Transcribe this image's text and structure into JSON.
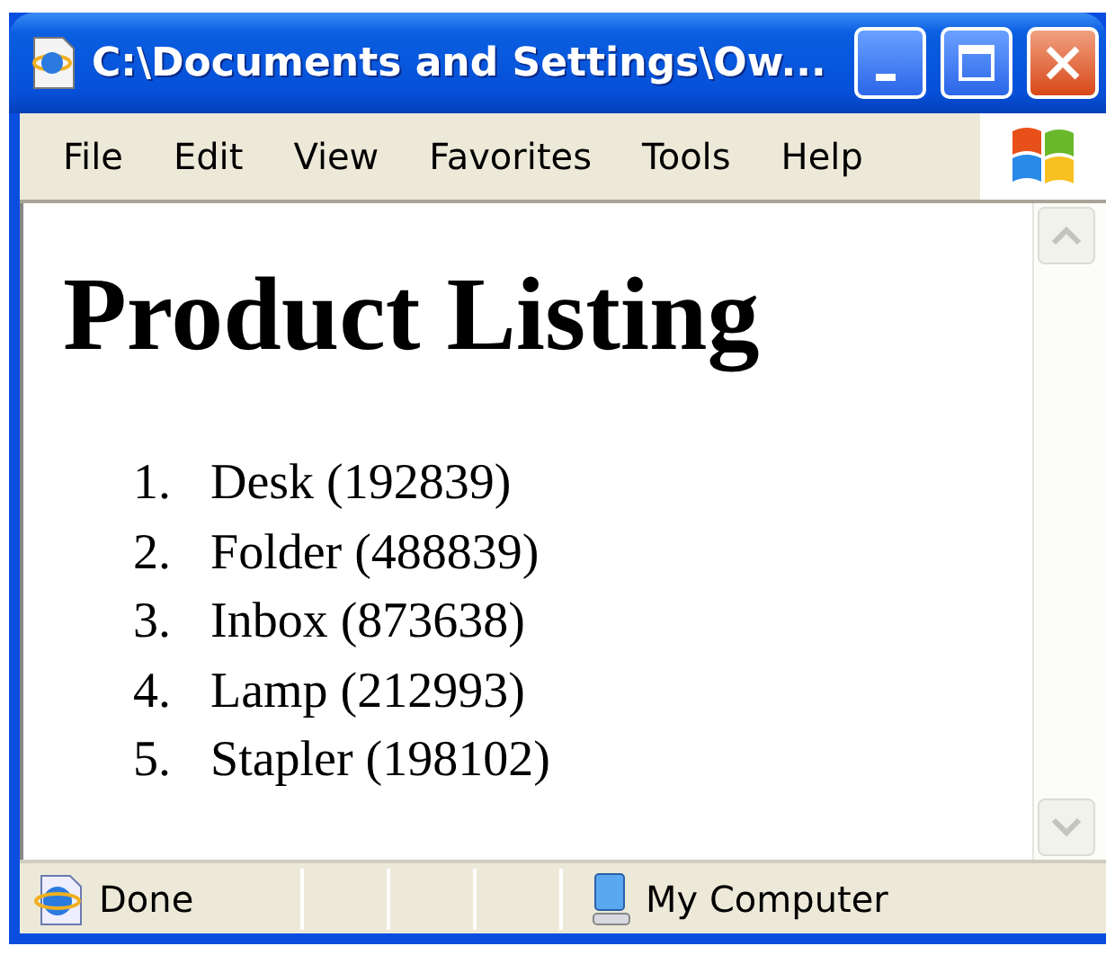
{
  "window": {
    "title": "C:\\Documents and Settings\\Ow..."
  },
  "menu": [
    "File",
    "Edit",
    "View",
    "Favorites",
    "Tools",
    "Help"
  ],
  "page": {
    "heading": "Product Listing",
    "items": [
      {
        "number": "1.",
        "text": "Desk (192839)"
      },
      {
        "number": "2.",
        "text": "Folder (488839)"
      },
      {
        "number": "3.",
        "text": "Inbox (873638)"
      },
      {
        "number": "4.",
        "text": "Lamp (212993)"
      },
      {
        "number": "5.",
        "text": "Stapler (198102)"
      }
    ]
  },
  "status_bar": {
    "status": "Done",
    "zone": "My Computer"
  }
}
